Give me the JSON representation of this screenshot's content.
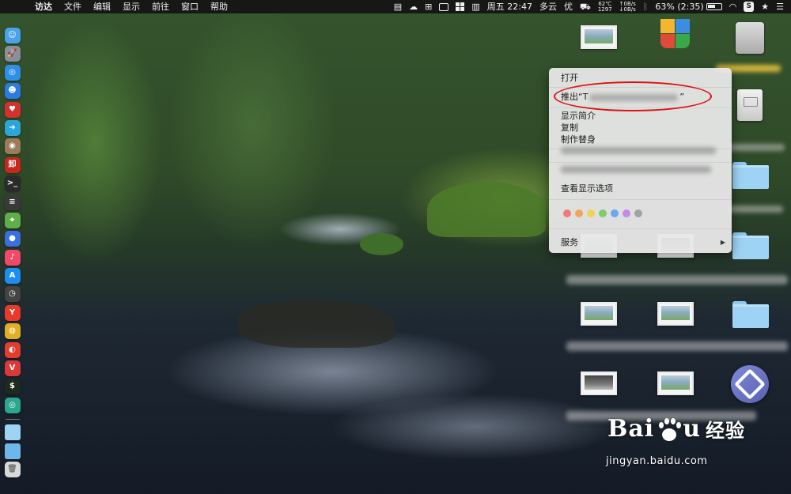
{
  "menubar": {
    "apple_glyph": "",
    "items": [
      "访达",
      "文件",
      "编辑",
      "显示",
      "前往",
      "窗口",
      "帮助"
    ],
    "status": {
      "datetime": "周五 22:47",
      "weather": "多云",
      "excellent_label": "优",
      "temp_top": "62℃",
      "temp_bottom": "1297",
      "net_up": "↑0B/s",
      "net_down": "↓0B/s",
      "battery": "63% (2:35)",
      "s_badge": "S"
    }
  },
  "dock": {
    "icons": [
      {
        "name": "finder-icon",
        "color": "#4aa3e8",
        "glyph": "☺"
      },
      {
        "name": "launchpad-icon",
        "color": "#8a8f99",
        "glyph": "🚀"
      },
      {
        "name": "safari-icon",
        "color": "#2f8ee6",
        "glyph": "◎"
      },
      {
        "name": "contacts-icon",
        "color": "#2c7be0",
        "glyph": "☻"
      },
      {
        "name": "cherry-app-icon",
        "color": "#d2322d",
        "glyph": "♥"
      },
      {
        "name": "migration-icon",
        "color": "#2aa7d6",
        "glyph": "➜"
      },
      {
        "name": "photo-app-icon",
        "color": "#9b7b5a",
        "glyph": "◉"
      },
      {
        "name": "red-app-icon",
        "color": "#c8261f",
        "glyph": "卸"
      },
      {
        "name": "terminal-icon",
        "color": "#2b2b2b",
        "glyph": ">_"
      },
      {
        "name": "console-icon",
        "color": "#3a3a3a",
        "glyph": "≡"
      },
      {
        "name": "maps-icon",
        "color": "#5fae4a",
        "glyph": "⌖"
      },
      {
        "name": "siri-icon",
        "color": "#3a6fe0",
        "glyph": "●"
      },
      {
        "name": "music-icon",
        "color": "#f04a6a",
        "glyph": "♪"
      },
      {
        "name": "app-store-icon",
        "color": "#1d8ef0",
        "glyph": "A"
      },
      {
        "name": "clock-icon",
        "color": "#444444",
        "glyph": "◷"
      },
      {
        "name": "yandex-icon",
        "color": "#e83a2b",
        "glyph": "Y"
      },
      {
        "name": "chrome-icon",
        "color": "#e0b023",
        "glyph": "◍"
      },
      {
        "name": "weibo-icon",
        "color": "#e23d2f",
        "glyph": "◐"
      },
      {
        "name": "vivaldi-icon",
        "color": "#d83a3a",
        "glyph": "V"
      },
      {
        "name": "iterm-icon",
        "color": "#1f2a1f",
        "glyph": "$"
      },
      {
        "name": "screen-app-icon",
        "color": "#2ca68f",
        "glyph": "◎"
      }
    ],
    "folder_icons": [
      {
        "name": "documents-folder-icon",
        "color": "#9fd3f5"
      },
      {
        "name": "downloads-folder-icon",
        "color": "#6fb6ea"
      }
    ],
    "trash_icon": {
      "name": "trash-icon",
      "color": "#d9d9d9"
    }
  },
  "context_menu": {
    "open_label": "打开",
    "eject_prefix": "推出“T",
    "eject_suffix": "”",
    "get_info_label": "显示简介",
    "duplicate_label": "复制",
    "make_alias_label": "制作替身",
    "view_options_label": "查看显示选项",
    "services_label": "服务",
    "tag_colors": [
      "#f07a7a",
      "#f2a55e",
      "#f0d356",
      "#7cce6a",
      "#6aa8ef",
      "#c48ae6",
      "#a3a3a3"
    ]
  },
  "highlight": {
    "color": "#dd1111"
  },
  "watermark": {
    "brand_left": "Bai",
    "brand_right": "u",
    "brand_cn": "经验",
    "url": "jingyan.baidu.com"
  }
}
